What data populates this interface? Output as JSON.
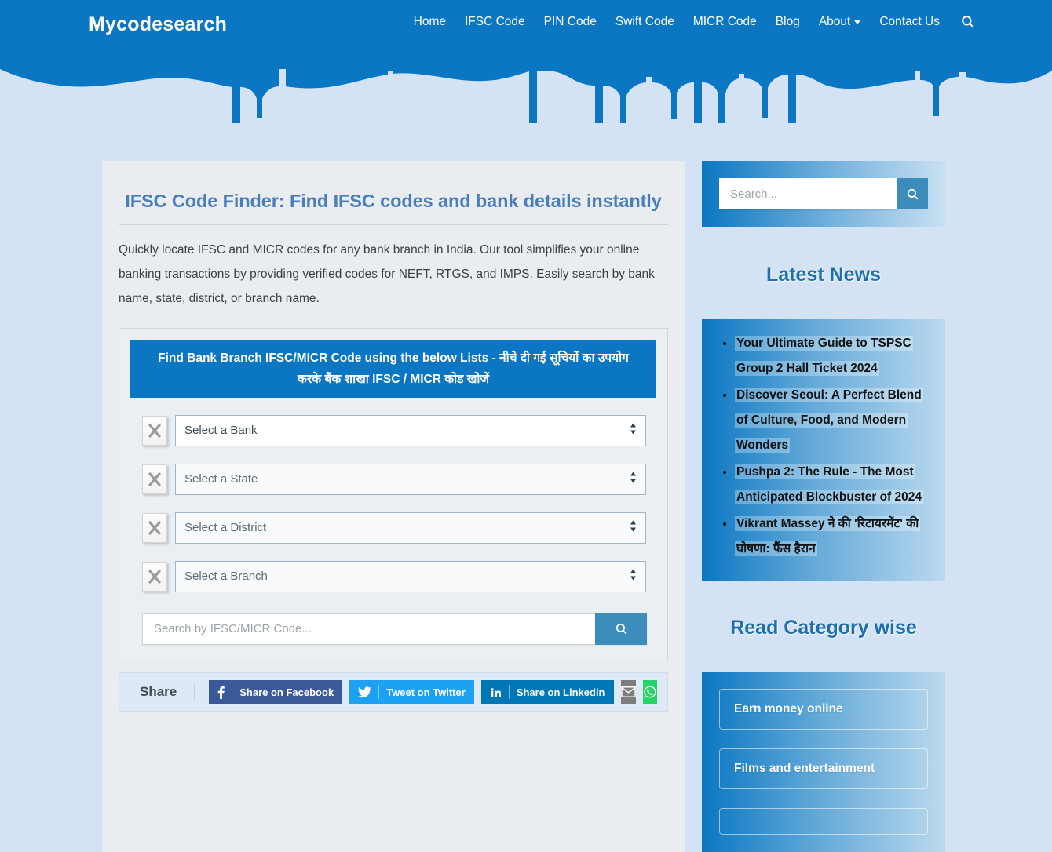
{
  "header": {
    "brand": "Mycodesearch",
    "nav": [
      {
        "label": "Home",
        "has_caret": false
      },
      {
        "label": "IFSC Code",
        "has_caret": false
      },
      {
        "label": "PIN Code",
        "has_caret": false
      },
      {
        "label": "Swift Code",
        "has_caret": false
      },
      {
        "label": "MICR Code",
        "has_caret": false
      },
      {
        "label": "Blog",
        "has_caret": false
      },
      {
        "label": "About",
        "has_caret": true
      },
      {
        "label": "Contact Us",
        "has_caret": false
      }
    ],
    "search_icon": "search-icon"
  },
  "main": {
    "title": "IFSC Code Finder: Find IFSC codes and bank details instantly",
    "intro": "Quickly locate  IFSC and MICR codes for any bank branch in India. Our tool simplifies your online banking transactions by providing verified codes for NEFT, RTGS, and IMPS. Easily search by bank name, state, district, or branch name.",
    "banner": "Find Bank Branch IFSC/MICR Code using the below Lists - नीचे दी गई सूचियों का उपयोग करके बैंक शाखा IFSC / MICR कोड खोजें",
    "selects": [
      {
        "name": "bank",
        "value": "Select a Bank"
      },
      {
        "name": "state",
        "value": "Select a State"
      },
      {
        "name": "district",
        "value": "Select a District"
      },
      {
        "name": "branch",
        "value": "Select a Branch"
      }
    ],
    "code_search": {
      "placeholder": "Search by IFSC/MICR Code...",
      "button_icon": "search-icon"
    }
  },
  "share": {
    "label": "Share",
    "buttons": [
      {
        "label": "Share on Facebook",
        "icon": "facebook-icon",
        "color": "#3b5998"
      },
      {
        "label": "Tweet on Twitter",
        "icon": "twitter-icon",
        "color": "#1da1f2"
      },
      {
        "label": "Share on Linkedin",
        "icon": "linkedin-icon",
        "color": "#0077b5"
      },
      {
        "label": "",
        "icon": "email-icon",
        "color": "#7d7d7d"
      },
      {
        "label": "",
        "icon": "whatsapp-icon",
        "color": "#25d366"
      }
    ]
  },
  "sidebar": {
    "search": {
      "placeholder": "Search...",
      "button_icon": "search-icon"
    },
    "news_heading": "Latest News",
    "news_items": [
      "Your Ultimate Guide to TSPSC Group 2 Hall Ticket 2024",
      "Discover Seoul: A Perfect Blend of Culture, Food, and Modern Wonders",
      "Pushpa 2: The Rule - The Most Anticipated Blockbuster of 2024",
      "Vikrant Massey ने की 'रिटायरमेंट' की घोषणा: फैंस हैरान"
    ],
    "category_heading": "Read Category wise",
    "categories": [
      "Earn money online",
      "Films and entertainment",
      ""
    ]
  },
  "colors": {
    "header_blue": "#0b77c2",
    "page_bg": "#d3e3f3",
    "card_bg": "#e9edef",
    "title_blue": "#4a7ebb",
    "accent_blue": "#3c8dbc",
    "heading_blue": "#1f6fad"
  }
}
